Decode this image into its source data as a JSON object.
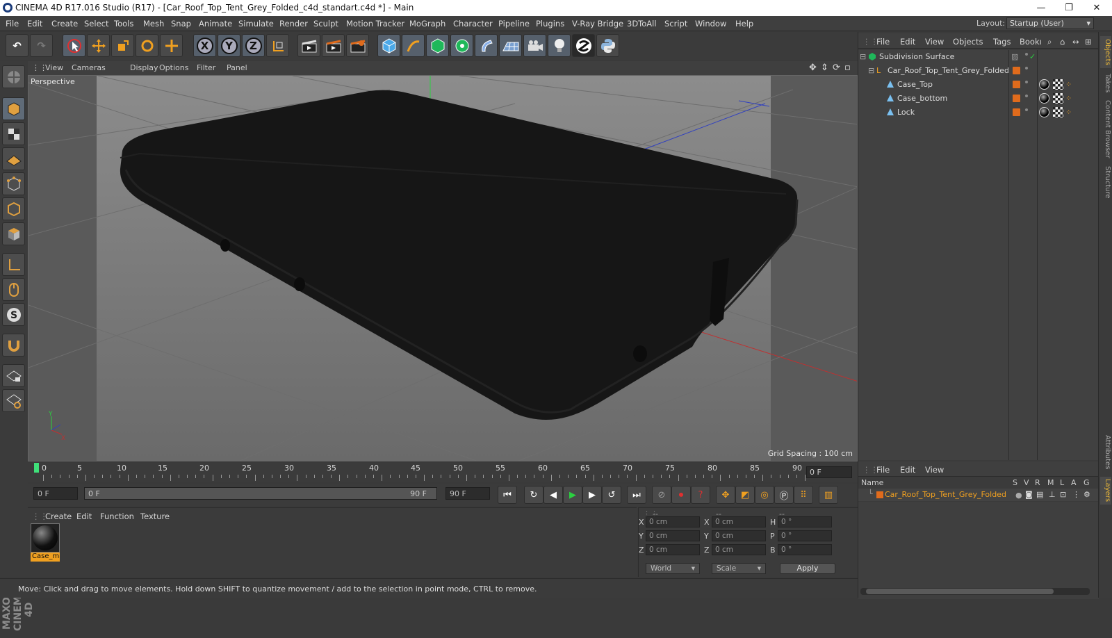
{
  "title": {
    "text": "CINEMA 4D R17.016 Studio (R17) - [Car_Roof_Top_Tent_Grey_Folded_c4d_standart.c4d *] - Main",
    "min": "—",
    "max": "❐",
    "close": "✕"
  },
  "menu": [
    "File",
    "Edit",
    "Create",
    "Select",
    "Tools",
    "Mesh",
    "Snap",
    "Animate",
    "Simulate",
    "Render",
    "Sculpt",
    "Motion Tracker",
    "MoGraph",
    "Character",
    "Pipeline",
    "Plugins",
    "V-Ray Bridge",
    "3DToAll",
    "Script",
    "Window",
    "Help"
  ],
  "layout": {
    "label": "Layout:",
    "value": "Startup (User)"
  },
  "toolbar": {
    "undo": "↶",
    "redo": "↷",
    "x": "X",
    "y": "Y",
    "z": "Z"
  },
  "viewport": {
    "menu": [
      "View",
      "Cameras",
      "Display",
      "Options",
      "Filter",
      "Panel"
    ],
    "label": "Perspective",
    "grid_spacing": "Grid Spacing : 100 cm",
    "axis_y": "Y",
    "axis_x": "X"
  },
  "timeline": {
    "ticks": [
      "0",
      "5",
      "10",
      "15",
      "20",
      "25",
      "30",
      "35",
      "40",
      "45",
      "50",
      "55",
      "60",
      "65",
      "70",
      "75",
      "80",
      "85",
      "90"
    ],
    "current": "0 F"
  },
  "transport": {
    "start": "0 F",
    "range_start": "0 F",
    "range_end": "90 F",
    "end": "90 F"
  },
  "materials": {
    "menu": [
      "Create",
      "Edit",
      "Function",
      "Texture"
    ],
    "item": "Case_ma"
  },
  "coords": {
    "headers": [
      "--",
      "--",
      "--"
    ],
    "rows": [
      [
        "X",
        "0 cm",
        "X",
        "0 cm",
        "H",
        "0 °"
      ],
      [
        "Y",
        "0 cm",
        "Y",
        "0 cm",
        "P",
        "0 °"
      ],
      [
        "Z",
        "0 cm",
        "Z",
        "0 cm",
        "B",
        "0 °"
      ]
    ],
    "mode1": "World",
    "mode2": "Scale",
    "apply": "Apply"
  },
  "status": "Move: Click and drag to move elements. Hold down SHIFT to quantize movement / add to the selection in point mode, CTRL to remove.",
  "objects_menu": [
    "File",
    "Edit",
    "View",
    "Objects",
    "Tags",
    "Bookı"
  ],
  "objects": [
    {
      "name": "Subdivision Surface",
      "indent": 0
    },
    {
      "name": "Car_Roof_Top_Tent_Grey_Folded",
      "indent": 1
    },
    {
      "name": "Case_Top",
      "indent": 2
    },
    {
      "name": "Case_bottom",
      "indent": 2
    },
    {
      "name": "Lock",
      "indent": 2
    }
  ],
  "layers_menu": [
    "File",
    "Edit",
    "View"
  ],
  "layer_headers": {
    "name": "Name",
    "cols": [
      "S",
      "V",
      "R",
      "M",
      "L",
      "A",
      "G"
    ]
  },
  "layer": "Car_Roof_Top_Tent_Grey_Folded",
  "right_tabs": [
    "Objects",
    "Takes",
    "Content Browser",
    "Structure",
    "Attributes",
    "Layers"
  ],
  "brand": "MAXON CINEMA 4D"
}
